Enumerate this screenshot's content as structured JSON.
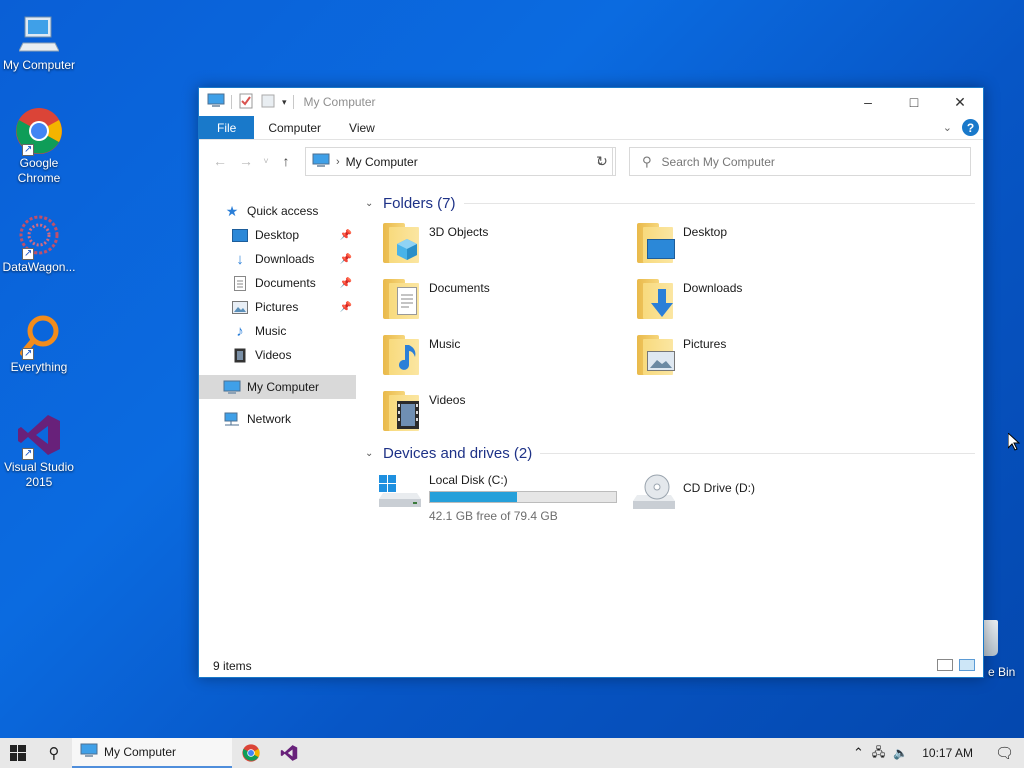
{
  "desktop": {
    "icons": [
      {
        "label": "My Computer"
      },
      {
        "label": "Google Chrome"
      },
      {
        "label": "DataWagon..."
      },
      {
        "label": "Everything"
      },
      {
        "label": "Visual Studio 2015"
      }
    ],
    "recycle_bin_label": "e Bin"
  },
  "window": {
    "title": "My Computer",
    "ribbon_tabs": [
      "File",
      "Computer",
      "View"
    ],
    "address": {
      "path": "My Computer"
    },
    "search": {
      "placeholder": "Search My Computer"
    },
    "nav_pane": {
      "quick_access": "Quick access",
      "quick_items": [
        {
          "label": "Desktop",
          "pinned": true
        },
        {
          "label": "Downloads",
          "pinned": true
        },
        {
          "label": "Documents",
          "pinned": true
        },
        {
          "label": "Pictures",
          "pinned": true
        },
        {
          "label": "Music",
          "pinned": false
        },
        {
          "label": "Videos",
          "pinned": false
        }
      ],
      "my_computer": "My Computer",
      "network": "Network"
    },
    "folders_group": "Folders (7)",
    "folders": [
      "3D Objects",
      "Desktop",
      "Documents",
      "Downloads",
      "Music",
      "Pictures",
      "Videos"
    ],
    "drives_group": "Devices and drives (2)",
    "drives": [
      {
        "name": "Local Disk (C:)",
        "free_text": "42.1 GB free of 79.4 GB",
        "used_fraction": 0.47
      },
      {
        "name": "CD Drive (D:)"
      }
    ],
    "status": "9 items"
  },
  "taskbar": {
    "active_app": "My Computer",
    "time": "10:17 AM"
  },
  "colors": {
    "accent": "#1979ca",
    "group_heading": "#1e3287",
    "drive_fill": "#26a0da"
  }
}
